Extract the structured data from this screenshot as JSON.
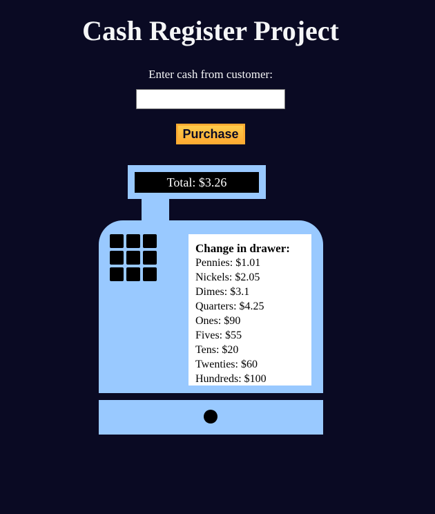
{
  "page": {
    "title": "Cash Register Project"
  },
  "form": {
    "cash_label": "Enter cash from customer:",
    "cash_value": "",
    "purchase_label": "Purchase"
  },
  "register": {
    "total_text": "Total: $3.26",
    "drawer_heading": "Change in drawer:",
    "drawer_items": [
      "Pennies: $1.01",
      "Nickels: $2.05",
      "Dimes: $3.1",
      "Quarters: $4.25",
      "Ones: $90",
      "Fives: $55",
      "Tens: $20",
      "Twenties: $60",
      "Hundreds: $100"
    ]
  },
  "colors": {
    "background": "#0a0a23",
    "register": "#99c9ff",
    "button": "#feac32",
    "display": "#000000"
  }
}
